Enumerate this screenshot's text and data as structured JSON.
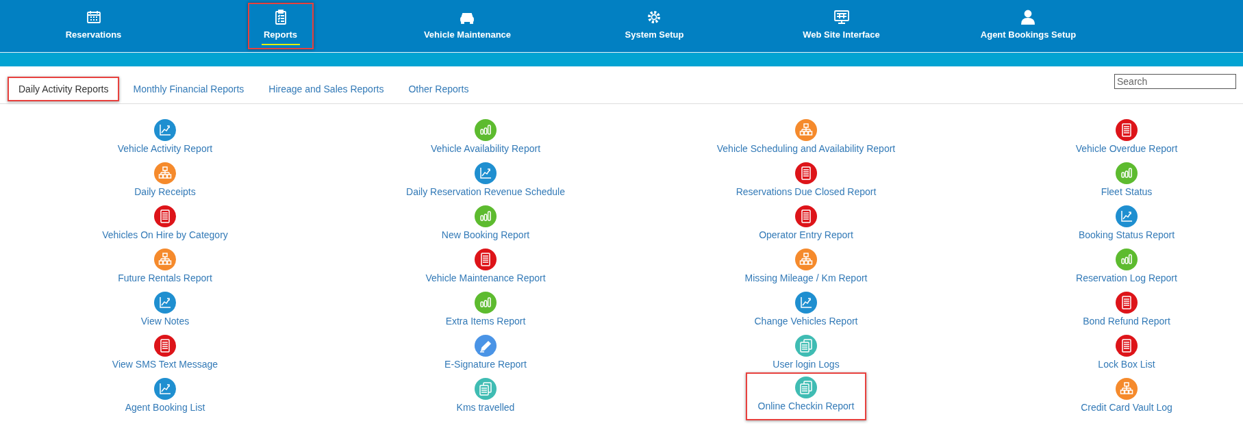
{
  "nav": [
    {
      "label": "Reservations",
      "kind": "calendar",
      "selected": false,
      "highlighted": false
    },
    {
      "label": "Reports",
      "kind": "clipboard",
      "selected": true,
      "highlighted": true
    },
    {
      "label": "Vehicle Maintenance",
      "kind": "car",
      "selected": false,
      "highlighted": false
    },
    {
      "label": "System Setup",
      "kind": "gear",
      "selected": false,
      "highlighted": false
    },
    {
      "label": "Web Site Interface",
      "kind": "monitor",
      "selected": false,
      "highlighted": false
    },
    {
      "label": "Agent Bookings Setup",
      "kind": "person",
      "selected": false,
      "highlighted": false
    }
  ],
  "tabs": [
    {
      "label": "Daily Activity Reports",
      "selected": true,
      "highlighted": true
    },
    {
      "label": "Monthly Financial Reports",
      "selected": false,
      "highlighted": false
    },
    {
      "label": "Hireage and Sales Reports",
      "selected": false,
      "highlighted": false
    },
    {
      "label": "Other Reports",
      "selected": false,
      "highlighted": false
    }
  ],
  "search": {
    "placeholder": "Search"
  },
  "columns": [
    [
      {
        "label": "Vehicle Activity Report",
        "kind": "chart",
        "highlighted": false
      },
      {
        "label": "Daily Receipts",
        "kind": "org",
        "highlighted": false
      },
      {
        "label": "Vehicles On Hire by Category",
        "kind": "doc",
        "highlighted": false
      },
      {
        "label": "Future Rentals Report",
        "kind": "org",
        "highlighted": false
      },
      {
        "label": "View Notes",
        "kind": "chart",
        "highlighted": false
      },
      {
        "label": "View SMS Text Message",
        "kind": "doc",
        "highlighted": false
      },
      {
        "label": "Agent Booking List",
        "kind": "chart",
        "highlighted": false
      }
    ],
    [
      {
        "label": "Vehicle Availability Report",
        "kind": "bars",
        "highlighted": false
      },
      {
        "label": "Daily Reservation Revenue Schedule",
        "kind": "chart",
        "highlighted": false
      },
      {
        "label": "New Booking Report",
        "kind": "bars",
        "highlighted": false
      },
      {
        "label": "Vehicle Maintenance Report",
        "kind": "doc",
        "highlighted": false
      },
      {
        "label": "Extra Items Report",
        "kind": "bars",
        "highlighted": false
      },
      {
        "label": "E-Signature Report",
        "kind": "pen",
        "highlighted": false
      },
      {
        "label": "Kms travelled",
        "kind": "files",
        "highlighted": false
      }
    ],
    [
      {
        "label": "Vehicle Scheduling and Availability Report",
        "kind": "org",
        "highlighted": false
      },
      {
        "label": "Reservations Due Closed Report",
        "kind": "doc",
        "highlighted": false
      },
      {
        "label": "Operator Entry Report",
        "kind": "doc",
        "highlighted": false
      },
      {
        "label": "Missing Mileage / Km Report",
        "kind": "org",
        "highlighted": false
      },
      {
        "label": "Change Vehicles Report",
        "kind": "chart",
        "highlighted": false
      },
      {
        "label": "User login Logs",
        "kind": "files",
        "highlighted": false
      },
      {
        "label": "Online Checkin Report",
        "kind": "files",
        "highlighted": true
      }
    ],
    [
      {
        "label": "Vehicle Overdue Report",
        "kind": "doc",
        "highlighted": false
      },
      {
        "label": "Fleet Status",
        "kind": "bars",
        "highlighted": false
      },
      {
        "label": "Booking Status Report",
        "kind": "chart",
        "highlighted": false
      },
      {
        "label": "Reservation Log Report",
        "kind": "bars",
        "highlighted": false
      },
      {
        "label": "Bond Refund Report",
        "kind": "doc",
        "highlighted": false
      },
      {
        "label": "Lock Box List",
        "kind": "doc",
        "highlighted": false
      },
      {
        "label": "Credit Card Vault Log",
        "kind": "org",
        "highlighted": false
      }
    ]
  ]
}
